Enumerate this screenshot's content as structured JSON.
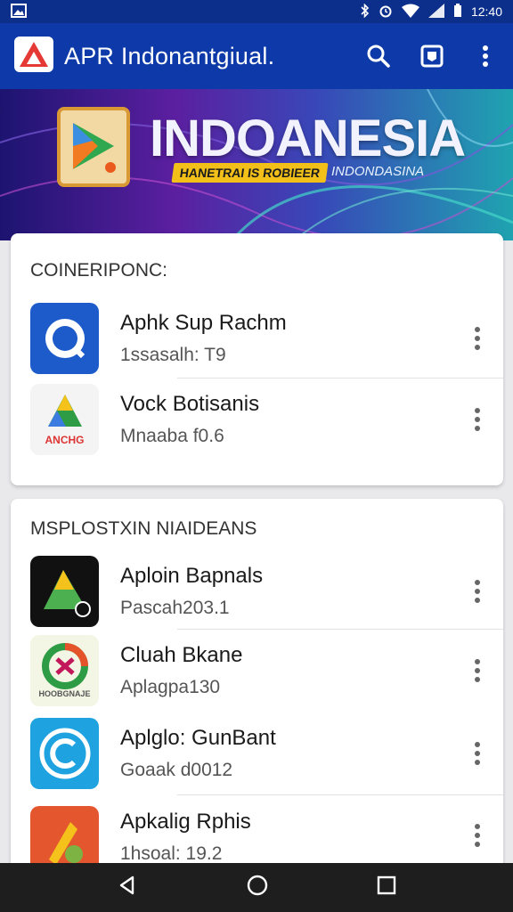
{
  "status": {
    "time": "12:40"
  },
  "appbar": {
    "title": "APR Indonantgiual."
  },
  "banner": {
    "headline": "INDOANESIA",
    "ribbon": "HANETRAI IS ROBIEER",
    "sub": "INDONDASINA"
  },
  "sections": [
    {
      "header": "COINERIPONC:",
      "items": [
        {
          "title": "Aphk Sup Rachm",
          "subtitle": "1ssasalh: T9"
        },
        {
          "title": "Vock Botisanis",
          "subtitle": "Mnaaba f0.6",
          "icon_text": "ANCHG"
        }
      ]
    },
    {
      "header": "MSPLOSTXIN NIAIDEANS",
      "items": [
        {
          "title": "Aploin Bapnals",
          "subtitle": "Pascah203.1"
        },
        {
          "title": "Cluah Bkane",
          "subtitle": "Aplagpa130",
          "icon_text": "HOOBGNAJE"
        },
        {
          "title": "Aplglo: GunBant",
          "subtitle": "Goaak d0012"
        },
        {
          "title": "Apkalig Rphis",
          "subtitle": "1hsoal: 19.2"
        }
      ]
    }
  ],
  "colors": {
    "appbar": "#0d3aa8",
    "statusbar": "#0c2f8c",
    "navbar": "#1e1e1e"
  }
}
